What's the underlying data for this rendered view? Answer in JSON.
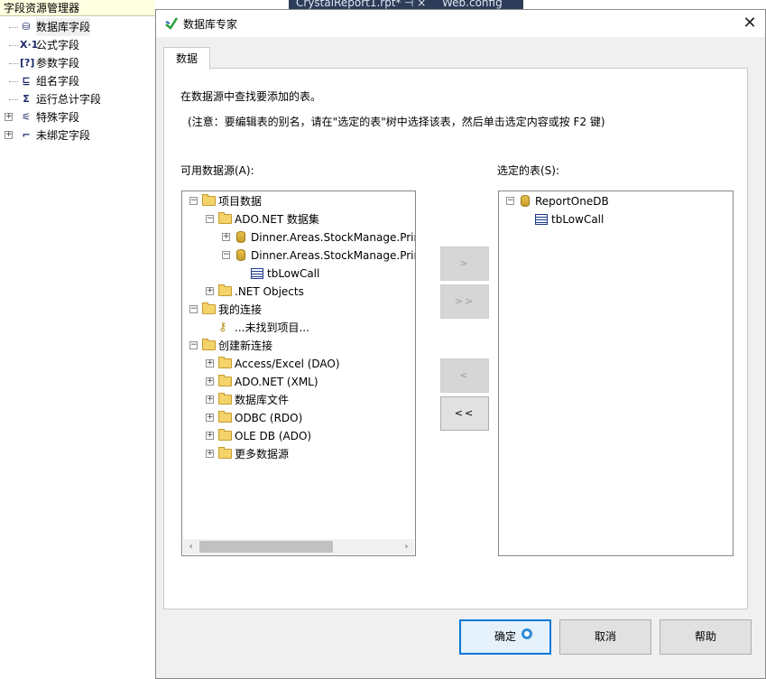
{
  "explorer": {
    "title": "字段资源管理器",
    "items": [
      {
        "label": "数据库字段",
        "icon": "database-icon",
        "glyph": "⛁",
        "expander": ""
      },
      {
        "label": "公式字段",
        "icon": "formula-icon",
        "glyph": "X·1",
        "expander": ""
      },
      {
        "label": "参数字段",
        "icon": "parameter-icon",
        "glyph": "[?]",
        "expander": ""
      },
      {
        "label": "组名字段",
        "icon": "group-name-icon",
        "glyph": "⊑",
        "expander": ""
      },
      {
        "label": "运行总计字段",
        "icon": "running-total-icon",
        "glyph": "Σ",
        "expander": ""
      },
      {
        "label": "特殊字段",
        "icon": "special-field-icon",
        "glyph": "⚟",
        "expander": "+"
      },
      {
        "label": "未绑定字段",
        "icon": "unbound-field-icon",
        "glyph": "⌐",
        "expander": "+"
      }
    ]
  },
  "background_tabs": [
    "CrystalReport1.rpt*",
    "⊣ ×",
    "Web.config"
  ],
  "dialog": {
    "title": "数据库专家",
    "close_glyph": "✕",
    "tab": "数据",
    "instruction": "在数据源中查找要添加的表。",
    "note": "(注意：要编辑表的别名，请在\"选定的表\"树中选择该表，然后单击选定内容或按 F2 键)",
    "available_label": "可用数据源(A):",
    "selected_label": "选定的表(S):",
    "available_tree": [
      {
        "label": "项目数据",
        "level": 0,
        "type": "folder",
        "exp": "−"
      },
      {
        "label": "ADO.NET 数据集",
        "level": 1,
        "type": "folder",
        "exp": "−"
      },
      {
        "label": "Dinner.Areas.StockManage.Prin",
        "level": 2,
        "type": "db",
        "exp": "+"
      },
      {
        "label": "Dinner.Areas.StockManage.Prin",
        "level": 2,
        "type": "db",
        "exp": "−"
      },
      {
        "label": "tbLowCall",
        "level": 3,
        "type": "table",
        "exp": ""
      },
      {
        "label": ".NET Objects",
        "level": 1,
        "type": "folder",
        "exp": "+"
      },
      {
        "label": "我的连接",
        "level": 0,
        "type": "folder",
        "exp": "−"
      },
      {
        "label": "...未找到项目...",
        "level": 1,
        "type": "key",
        "exp": ""
      },
      {
        "label": "创建新连接",
        "level": 0,
        "type": "folder",
        "exp": "−"
      },
      {
        "label": "Access/Excel (DAO)",
        "level": 1,
        "type": "folder",
        "exp": "+"
      },
      {
        "label": "ADO.NET (XML)",
        "level": 1,
        "type": "folder",
        "exp": "+"
      },
      {
        "label": "数据库文件",
        "level": 1,
        "type": "folder",
        "exp": "+"
      },
      {
        "label": "ODBC (RDO)",
        "level": 1,
        "type": "folder",
        "exp": "+"
      },
      {
        "label": "OLE DB (ADO)",
        "level": 1,
        "type": "folder",
        "exp": "+"
      },
      {
        "label": "更多数据源",
        "level": 1,
        "type": "folder",
        "exp": "+"
      }
    ],
    "selected_tree": [
      {
        "label": "ReportOneDB",
        "level": 0,
        "type": "db",
        "exp": "−"
      },
      {
        "label": "tbLowCall",
        "level": 1,
        "type": "table",
        "exp": ""
      }
    ],
    "scroll_left": "‹",
    "scroll_right": "›",
    "buttons": {
      "add_one": ">",
      "add_all": ">>",
      "remove_one": "<",
      "remove_all": "<<",
      "ok": "确定",
      "cancel": "取消",
      "help": "帮助"
    }
  }
}
